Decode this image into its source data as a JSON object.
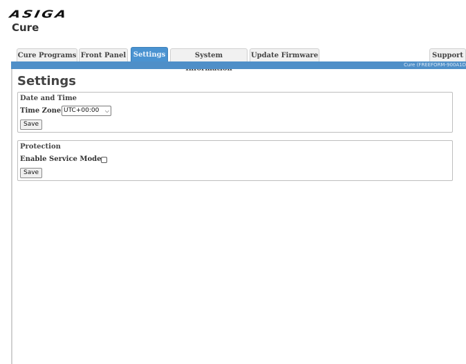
{
  "header": {
    "logo_text": "ASIGA",
    "app_title": "Cure"
  },
  "tabs": [
    {
      "label": "Cure Programs",
      "active": false
    },
    {
      "label": "Front Panel",
      "active": false
    },
    {
      "label": "Settings",
      "active": true
    },
    {
      "label": "System Information",
      "active": false
    },
    {
      "label": "Update Firmware",
      "active": false
    },
    {
      "label": "Support",
      "active": false
    }
  ],
  "status_bar": {
    "text": "Cure (FREEFORM-900A1D"
  },
  "page": {
    "title": "Settings"
  },
  "date_time_section": {
    "title": "Date and Time",
    "time_zone_label": "Time Zone",
    "time_zone_value": "UTC+00:00",
    "save_label": "Save"
  },
  "protection_section": {
    "title": "Protection",
    "service_mode_label": "Enable Service Mode",
    "service_mode_checked": false,
    "save_label": "Save"
  },
  "colors": {
    "accent": "#4f8fc8",
    "active_tab": "#4a93d1"
  }
}
